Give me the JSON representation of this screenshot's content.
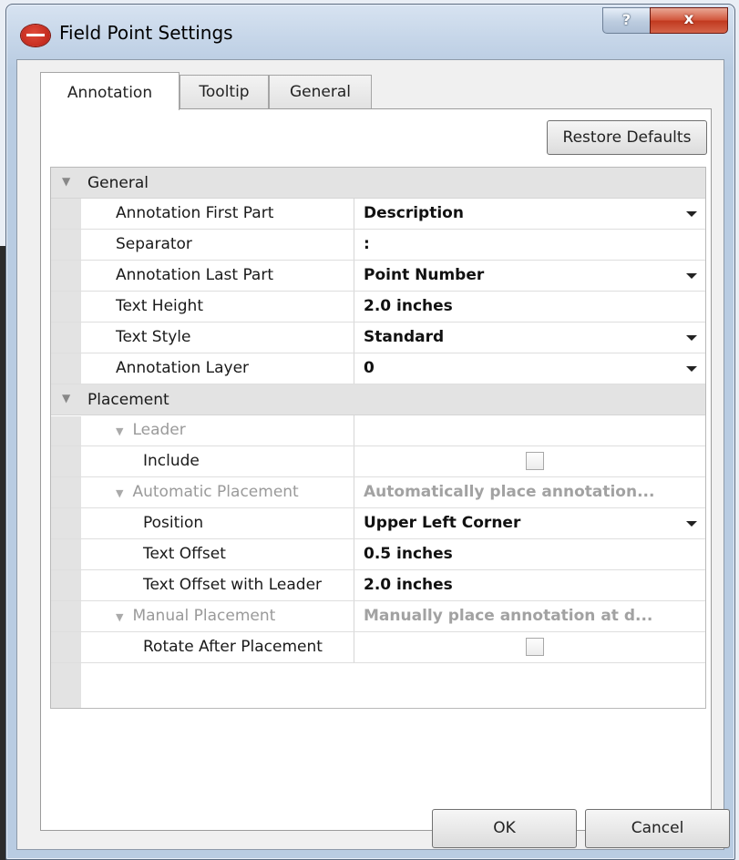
{
  "window": {
    "title": "Field Point Settings",
    "help_label": "?",
    "close_label": "x"
  },
  "tabs": [
    {
      "label": "Annotation",
      "active": true
    },
    {
      "label": "Tooltip",
      "active": false
    },
    {
      "label": "General",
      "active": false
    }
  ],
  "restore_defaults_label": "Restore Defaults",
  "general": {
    "category": "General",
    "properties": [
      {
        "name": "Annotation First Part",
        "value": "Description"
      },
      {
        "name": "Separator",
        "value": ":"
      },
      {
        "name": "Annotation Last Part",
        "value": "Point Number"
      },
      {
        "name": "Text Height",
        "value": "2.0 inches"
      },
      {
        "name": "Text Style",
        "value": "Standard"
      },
      {
        "name": "Annotation Layer",
        "value": "0"
      }
    ]
  },
  "placement": {
    "category": "Placement",
    "leader": {
      "label": "Leader",
      "include_label": "Include",
      "include_checked": false
    },
    "automatic": {
      "label": "Automatic Placement",
      "description": "Automatically place annotation...",
      "position_label": "Position",
      "position_value": "Upper Left Corner",
      "offset_label": "Text Offset",
      "offset_value": "0.5 inches",
      "offset_leader_label": "Text Offset with Leader",
      "offset_leader_value": "2.0 inches"
    },
    "manual": {
      "label": "Manual Placement",
      "description": "Manually place annotation at d...",
      "rotate_label": "Rotate After Placement",
      "rotate_checked": false
    }
  },
  "buttons": {
    "ok": "OK",
    "cancel": "Cancel"
  }
}
